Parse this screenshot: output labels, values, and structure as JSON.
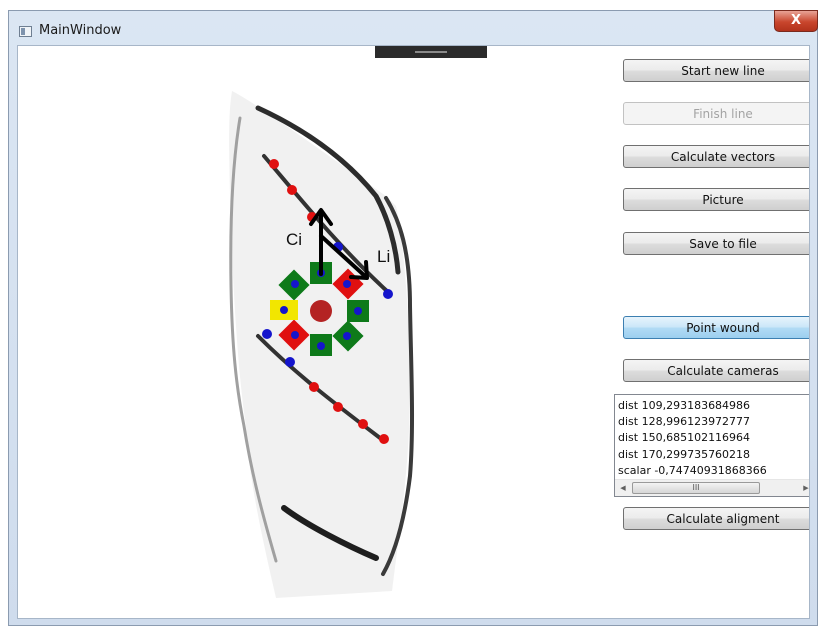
{
  "window": {
    "title": "MainWindow",
    "close_label": "X"
  },
  "canvas": {
    "labels": {
      "ci": "Ci",
      "li": "Li"
    }
  },
  "buttons": {
    "start_new_line": "Start new line",
    "finish_line": "Finish line",
    "calculate_vectors": "Calculate vectors",
    "picture": "Picture",
    "save_to_file": "Save to file",
    "point_wound": "Point wound",
    "calculate_cameras": "Calculate cameras",
    "calculate_alignment": "Calculate aligment"
  },
  "output_list": {
    "items": [
      "dist 109,293183684986",
      "dist 128,996123972777",
      "dist 150,685102116964",
      "dist 170,299735760218",
      "scalar -0,74740931868366"
    ],
    "hscroll_grip": "III"
  },
  "colors": {
    "red_marker": "#e01010",
    "blue_marker": "#1515cc",
    "green_marker": "#0e7a1a",
    "yellow_marker": "#f2e600",
    "center_marker": "#b42323"
  }
}
